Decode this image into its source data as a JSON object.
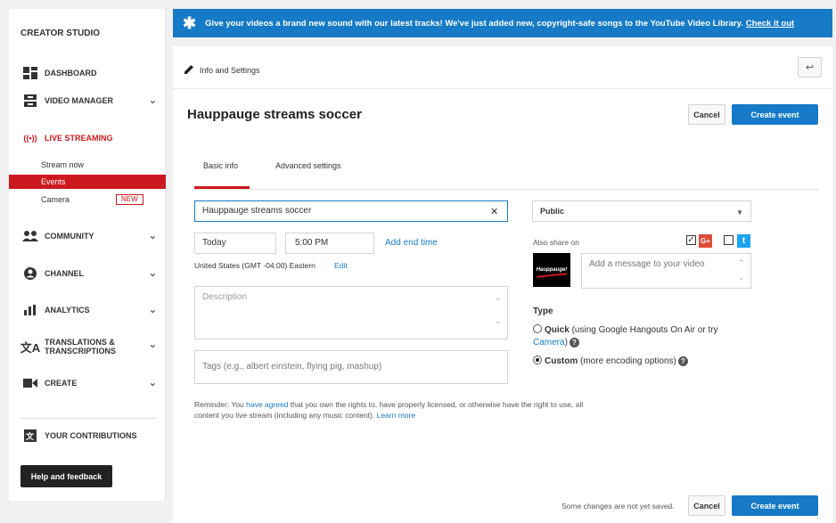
{
  "sidebar": {
    "title": "CREATOR STUDIO",
    "items": [
      {
        "label": "DASHBOARD",
        "icon": "dashboard-icon"
      },
      {
        "label": "VIDEO MANAGER",
        "icon": "video-manager-icon"
      },
      {
        "label": "LIVE STREAMING",
        "icon": "live-streaming-icon"
      },
      {
        "label": "COMMUNITY",
        "icon": "community-icon"
      },
      {
        "label": "CHANNEL",
        "icon": "channel-icon"
      },
      {
        "label": "ANALYTICS",
        "icon": "analytics-icon"
      },
      {
        "label": "TRANSLATIONS & TRANSCRIPTIONS",
        "icon": "translations-icon"
      },
      {
        "label": "CREATE",
        "icon": "create-icon"
      },
      {
        "label": "YOUR CONTRIBUTIONS",
        "icon": "contributions-icon"
      }
    ],
    "live_sub": [
      "Stream now",
      "Events",
      "Camera"
    ],
    "new_badge": "NEW",
    "help_button": "Help and feedback"
  },
  "banner": {
    "text": "Give your videos a brand new sound with our latest tracks! We've just added new, copyright-safe songs to the YouTube Video Library.",
    "link": "Check it out"
  },
  "toolbar": {
    "label": "Info and Settings"
  },
  "event": {
    "title": "Hauppauge streams soccer"
  },
  "buttons": {
    "cancel": "Cancel",
    "create": "Create event"
  },
  "tabs": [
    "Basic info",
    "Advanced settings"
  ],
  "form": {
    "title_value": "Hauppauge streams soccer",
    "date": "Today",
    "time": "5:00 PM",
    "add_end_time": "Add end time",
    "timezone": "United States (GMT -04:00) Eastern",
    "edit": "Edit",
    "description_placeholder": "Description",
    "tags_placeholder": "Tags (e.g., albert einstein, flying pig, mashup)",
    "reminder_before": "Reminder: You",
    "reminder_link": "have agreed",
    "reminder_after": "that you own the rights to, have properly licensed, or otherwise have the right to use, all content you live stream (including any music content).",
    "learn_more": "Learn more"
  },
  "privacy": {
    "selected": "Public"
  },
  "share": {
    "label": "Also share on",
    "gplus_checked": true,
    "twitter_checked": false,
    "logo_text": "Hauppauge!",
    "message_placeholder": "Add a message to your video"
  },
  "type": {
    "label": "Type",
    "quick_bold": "Quick",
    "quick_rest": "(using Google Hangouts On Air or try",
    "quick_link": "Camera",
    "custom_bold": "Custom",
    "custom_rest": "(more encoding options)",
    "selected": "custom"
  },
  "footer": {
    "unsaved": "Some changes are not yet saved."
  },
  "colors": {
    "brand_red": "#cc181e",
    "accent_blue": "#167ac6"
  }
}
